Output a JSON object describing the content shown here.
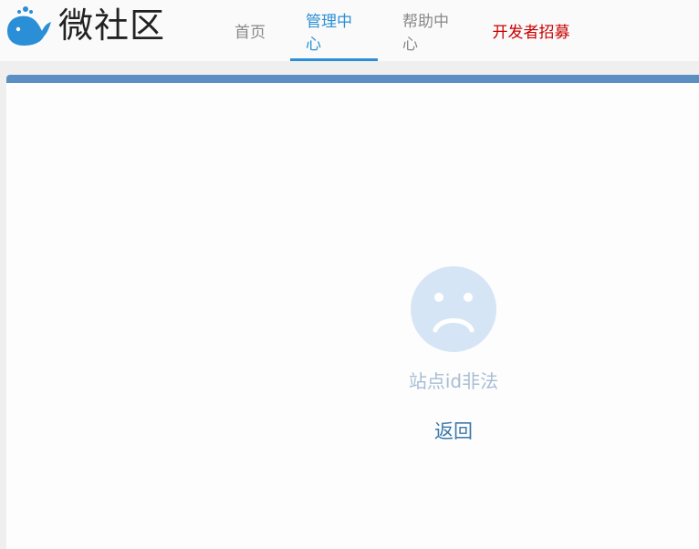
{
  "header": {
    "logo_icon": "whale-icon",
    "logo_text": "微社区",
    "nav": [
      {
        "label": "首页"
      },
      {
        "label": "管理中心"
      },
      {
        "label": "帮助中心"
      },
      {
        "label": "开发者招募"
      }
    ]
  },
  "main": {
    "icon": "sad-face-icon",
    "message": "站点id非法",
    "back_label": "返回"
  },
  "colors": {
    "brand_blue": "#2a8fd6",
    "panel_bar": "#5b8fc4",
    "recruit_red": "#c80000",
    "face": "#d6e5f5"
  }
}
